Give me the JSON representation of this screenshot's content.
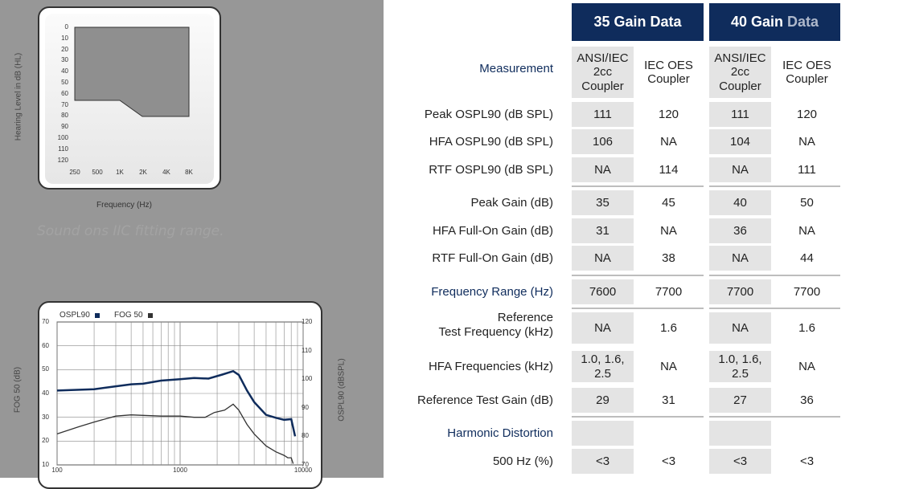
{
  "audiogram": {
    "y_axis_label": "Hearing Level in dB (HL)",
    "y_ticks": [
      "0",
      "10",
      "20",
      "30",
      "40",
      "50",
      "60",
      "70",
      "80",
      "90",
      "100",
      "110",
      "120"
    ],
    "x_ticks": [
      "250",
      "500",
      "1K",
      "2K",
      "4K",
      "8K"
    ],
    "x_axis_label": "Frequency (Hz)",
    "fitting_range_caption": "Sound ons IIC fitting range."
  },
  "response_chart": {
    "legend_ospl90": "OSPL90",
    "legend_fog50": "FOG 50",
    "left_axis_label": "FOG 50 (dB)",
    "right_axis_label": "OSPL90 (dBSPL)",
    "left_ticks": [
      "70",
      "60",
      "50",
      "40",
      "30",
      "20",
      "10"
    ],
    "right_ticks": [
      "120",
      "110",
      "100",
      "90",
      "80",
      "70"
    ],
    "x_ticks": [
      "100",
      "1000",
      "10000"
    ],
    "ospl90_color": "#0f2c5c",
    "fog50_color": "#333333"
  },
  "table": {
    "header_35": "35 Gain",
    "header_35_accent": "Data",
    "header_40": "40 Gain",
    "header_40_accent": "Data",
    "measurement_label": "Measurement",
    "coupler_ansi": "ANSI/IEC 2cc Coupler",
    "coupler_oes": "IEC OES Coupler",
    "rows": [
      {
        "label": "Peak OSPL90 (dB SPL)",
        "v": [
          "111",
          "120",
          "111",
          "120"
        ]
      },
      {
        "label": "HFA OSPL90 (dB SPL)",
        "v": [
          "106",
          "NA",
          "104",
          "NA"
        ]
      },
      {
        "label": "RTF OSPL90 (dB SPL)",
        "v": [
          "NA",
          "114",
          "NA",
          "111"
        ]
      },
      {
        "label": "Peak Gain (dB)",
        "v": [
          "35",
          "45",
          "40",
          "50"
        ]
      },
      {
        "label": "HFA Full-On Gain (dB)",
        "v": [
          "31",
          "NA",
          "36",
          "NA"
        ]
      },
      {
        "label": "RTF Full-On Gain (dB)",
        "v": [
          "NA",
          "38",
          "NA",
          "44"
        ]
      },
      {
        "label": "Frequency Range (Hz)",
        "v": [
          "7600",
          "7700",
          "7700",
          "7700"
        ]
      },
      {
        "label": "Reference Test Frequency (kHz)",
        "v": [
          "NA",
          "1.6",
          "NA",
          "1.6"
        ]
      },
      {
        "label": "HFA Frequencies (kHz)",
        "v": [
          "1.0, 1.6, 2.5",
          "NA",
          "1.0, 1.6, 2.5",
          "NA"
        ]
      },
      {
        "label": "Reference Test Gain (dB)",
        "v": [
          "29",
          "31",
          "27",
          "36"
        ]
      },
      {
        "label": "Harmonic Distortion",
        "v": [
          "",
          "",
          "",
          ""
        ]
      },
      {
        "label": "500 Hz (%)",
        "v": [
          "<3",
          "<3",
          "<3",
          "<3"
        ]
      }
    ]
  }
}
